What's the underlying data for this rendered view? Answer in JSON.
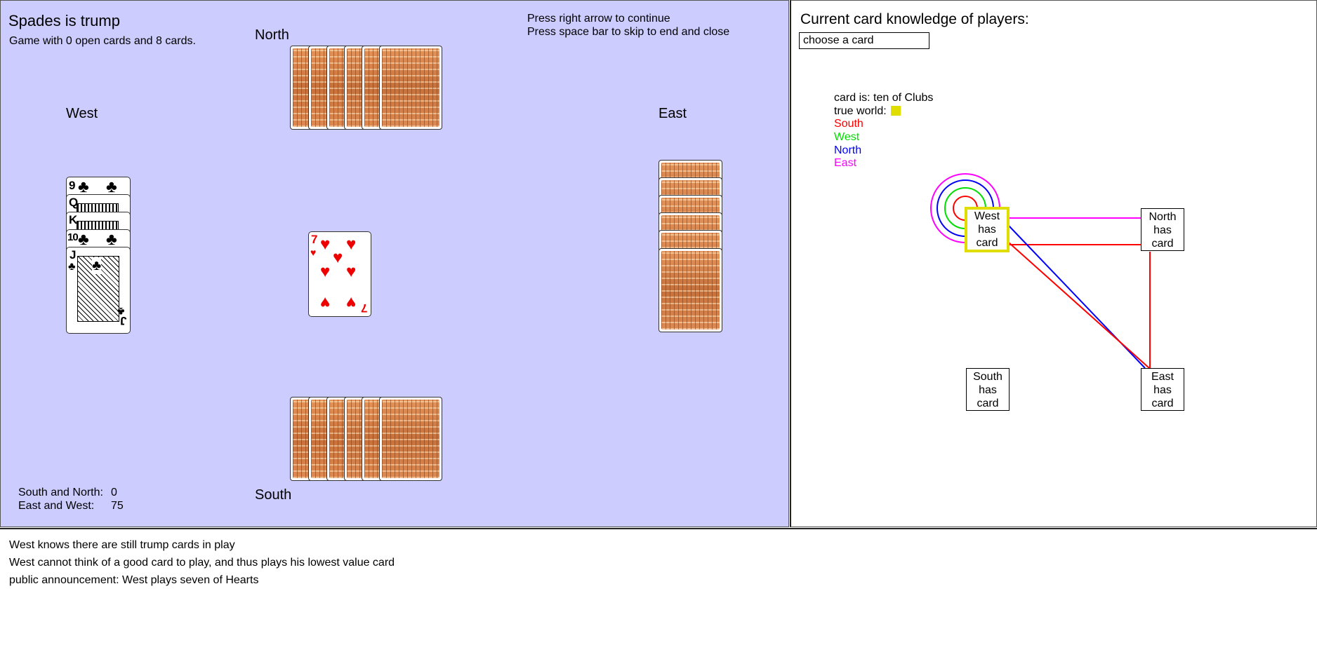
{
  "game": {
    "trump_text": "Spades is trump",
    "subtitle": "Game with 0 open cards and 8 cards.",
    "instructions": [
      "Press right arrow to continue",
      "Press space bar to skip to end and close"
    ],
    "players": {
      "north": "North",
      "south": "South",
      "east": "East",
      "west": "West"
    },
    "score": {
      "south_north_label": "South and North:",
      "south_north_value": "0",
      "east_west_label": "East and West:",
      "east_west_value": "75"
    },
    "west_hand": [
      {
        "rank": "9",
        "suit": "♣"
      },
      {
        "rank": "Q",
        "suit": "♣"
      },
      {
        "rank": "K",
        "suit": "♣"
      },
      {
        "rank": "10",
        "suit": "♣"
      },
      {
        "rank": "J",
        "suit": "♣"
      }
    ],
    "played_card": {
      "rank": "7",
      "suit": "♥",
      "color": "#e00000"
    },
    "north_card_count": 6,
    "south_card_count": 6,
    "east_card_count": 6
  },
  "knowledge": {
    "title": "Current card knowledge of players:",
    "select_value": "choose a card",
    "card_is": "card is: ten of Clubs",
    "true_world_label": "true world:",
    "true_world_color": "#e0dd00",
    "legend": [
      {
        "name": "South",
        "color": "#ff0000"
      },
      {
        "name": "West",
        "color": "#00e000"
      },
      {
        "name": "North",
        "color": "#0000ff"
      },
      {
        "name": "East",
        "color": "#ff00ff"
      }
    ],
    "worlds": {
      "west": [
        "West",
        "has",
        "card"
      ],
      "north": [
        "North",
        "has",
        "card"
      ],
      "south": [
        "South",
        "has",
        "card"
      ],
      "east": [
        "East",
        "has",
        "card"
      ]
    }
  },
  "log": {
    "lines": [
      "West knows there are still trump cards in play",
      "West cannot think of a good card to play, and thus plays his lowest value card",
      "public announcement: West plays seven of Hearts"
    ]
  }
}
